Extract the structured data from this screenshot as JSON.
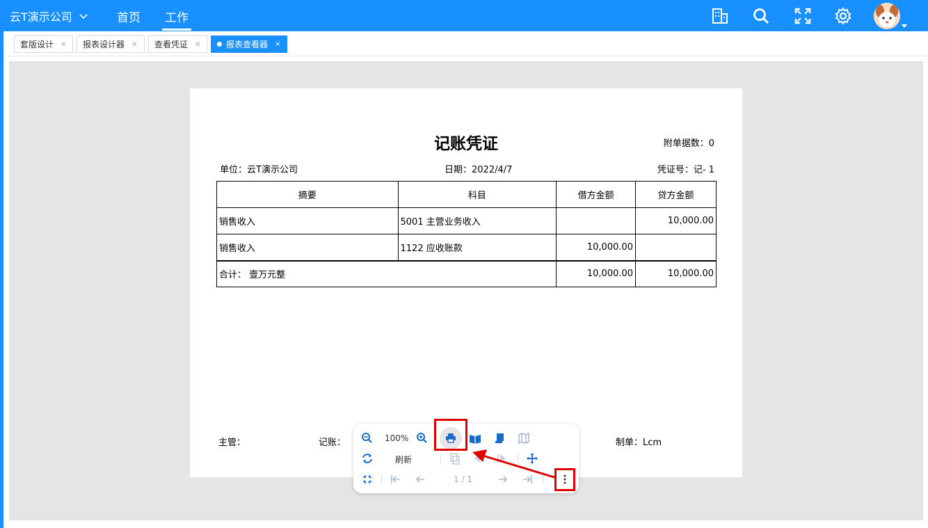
{
  "header": {
    "company": "云T演示公司",
    "nav": [
      "首页",
      "工作"
    ],
    "icons": [
      "building-icon",
      "search-icon",
      "fullscreen-icon",
      "gear-icon"
    ],
    "accent_color": "#1890ff"
  },
  "tabs": [
    {
      "label": "套版设计",
      "close": "×"
    },
    {
      "label": "报表设计器",
      "close": "×"
    },
    {
      "label": "查看凭证",
      "close": "×"
    },
    {
      "label": "报表查看器",
      "close": "×",
      "active": true
    }
  ],
  "voucher": {
    "title": "记账凭证",
    "attachments": "附单据数：0",
    "unit": "单位：云T演示公司",
    "date": "日期：2022/4/7",
    "voucher_no": "凭证号：记- 1",
    "columns": [
      "摘要",
      "科目",
      "借方金额",
      "贷方金额"
    ],
    "rows": [
      {
        "summary": "销售收入",
        "account": "5001 主营业务收入",
        "debit": "",
        "credit": "10,000.00"
      },
      {
        "summary": "销售收入",
        "account": "1122 应收账款",
        "debit": "10,000.00",
        "credit": ""
      }
    ],
    "total": {
      "label": "合计：  壹万元整",
      "debit": "10,000.00",
      "credit": "10,000.00"
    },
    "signatures": {
      "supervisor": "主管：",
      "bookkeeper": "记账：",
      "preparer": "制单：Lcm"
    }
  },
  "toolbar": {
    "zoom": "100%",
    "refresh": "刷新",
    "page": "1 / 1"
  },
  "highlight_color": "#e00000"
}
